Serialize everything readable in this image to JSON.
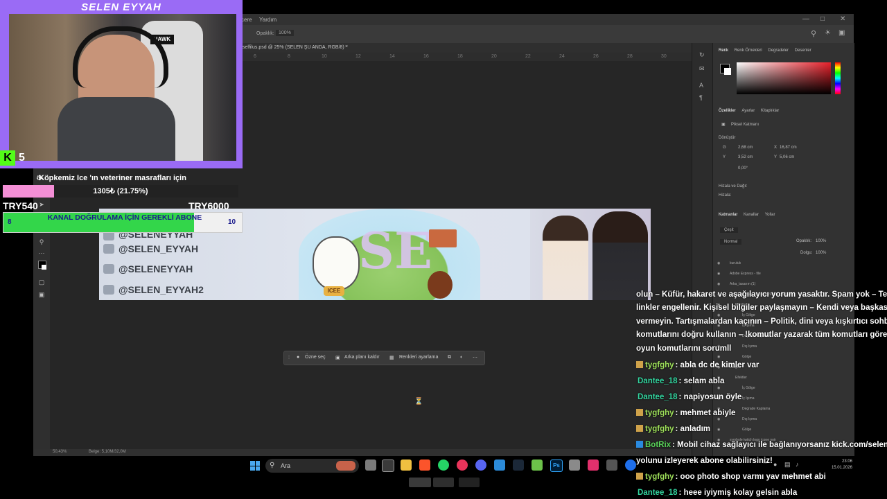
{
  "stream": {
    "streamer_name": "SELEN EYYAH",
    "kick_count": "5"
  },
  "photoshop": {
    "menu_visible": [
      "cere",
      "Yardım"
    ],
    "options": {
      "opacity_label": "Opaklık:",
      "opacity_value": "100%"
    },
    "document_tab": "selfilus.psd @ 25% (SELEN ŞU ANDA, RGB/8)",
    "ruler_ticks": [
      "6",
      "8",
      "10",
      "12",
      "14",
      "16",
      "18",
      "20",
      "22",
      "24",
      "26",
      "28",
      "30"
    ],
    "status_zoom": "50,43%",
    "status_size": "Belge: 5,10M/32,0M",
    "context_bar": {
      "select_label": "Özne seç",
      "remove_bg_label": "Arka planı kaldır",
      "color_adjust_label": "Renkleri ayarlama"
    },
    "panels": {
      "color_tabs": [
        "Renk",
        "Renk Örnekleri",
        "Degradeler",
        "Desenler"
      ],
      "props_tabs": [
        "Özellikler",
        "Ayarlar",
        "Kitaplıklar"
      ],
      "smart_object": "Piksel Katmanı",
      "transform_label": "Dönüştür",
      "w": "2,68 cm",
      "h": "3,52 cm",
      "x": "16,87 cm",
      "y": "5,06 cm",
      "angle": "0,00°",
      "align_label": "Hizala ve Dağıt",
      "align_sub": "Hizala:",
      "layers_tabs": [
        "Katmanlar",
        "Kanallar",
        "Yollar"
      ],
      "kind_label": "Çeşit",
      "blend_mode": "Normal",
      "opacity_label": "Opaklık:",
      "opacity_value": "100%",
      "fill_label": "Dolgu:",
      "fill_value": "100%",
      "layers": [
        "kuruluk",
        "Adobe Express - file",
        "Arka_tasarım (1)",
        "ChatGPT Image 15 Oca 2026 22_53_25",
        "Efektler",
        "İç Gölge",
        "İç Işıma",
        "Degrade Kaplama",
        "Dış Işıma",
        "Gölge",
        "images",
        "Efektler",
        "İç Gölge",
        "İç Işıma",
        "Degrade Kaplama",
        "Dış Işıma",
        "Gölge",
        "symbole twitch logo icone noir"
      ]
    }
  },
  "banner": {
    "handles": [
      "@SELENEYYAH",
      "@SELEN_EYYAH",
      "@SELENEYYAH",
      "@SELEN_EYYAH2"
    ],
    "dog_tag": "ICEE",
    "monogram": "SE"
  },
  "goal": {
    "title": "Köpkemiz Ice 'ın veteriner masrafları için",
    "progress_text": "1305₺ (21.75%)",
    "progress_fraction": 0.2175,
    "min_label": "TRY540",
    "max_label": "TRY6000",
    "fill_color": "#f48fd6"
  },
  "sub_goal": {
    "text": "KANAL DOĞRULAMA İÇİN GEREKLİ ABONE",
    "current": "8",
    "target": "10",
    "progress_fraction": 0.8,
    "fill_color": "#33d64a"
  },
  "chat": {
    "rules": [
      "olun – Küfür, hakaret ve aşağılayıcı yorum yasaktır. Spam yok – Tekrarlayan",
      "linkler engellenir. Kişisel bilgiler paylaşmayın – Kendi veya başkasının bilgil",
      "vermeyin. Tartışmalardan kaçının – Politik, dini veya kışkırtıcı sohbetler yas",
      "komutlarını doğru kullanın – !komutlar yazarak tüm komutları görebilirsiniz.",
      "oyun komutlarını sorumll"
    ],
    "messages": [
      {
        "user": "tygfghy",
        "color": "#9ee05a",
        "badge": true,
        "text": ": abla dc de kimler var"
      },
      {
        "user": "Dantee_18",
        "color": "#33d6a0",
        "badge": false,
        "text": ": selam abla"
      },
      {
        "user": "Dantee_18",
        "color": "#33d6a0",
        "badge": false,
        "text": ": napiyosun öyle"
      },
      {
        "user": "tygfghy",
        "color": "#9ee05a",
        "badge": true,
        "text": ": mehmet abiyle"
      },
      {
        "user": "tygfghy",
        "color": "#9ee05a",
        "badge": true,
        "text": ": anladım"
      },
      {
        "user": "BotRix",
        "color": "#5ad65a",
        "badge": true,
        "text": ": Mobil cihaz sağlayıcı ile bağlanıyorsanız kick.com/seleneyyah"
      },
      {
        "user": "",
        "color": "#ffffff",
        "badge": false,
        "text": "yolunu izleyerek abone olabilirsiniz!"
      },
      {
        "user": "tygfghy",
        "color": "#9ee05a",
        "badge": true,
        "text": ": ooo photo shop varmı yav mehmet abi"
      },
      {
        "user": "Dantee_18",
        "color": "#33d6a0",
        "badge": false,
        "text": ": heee iyiymiş kolay gelsin abla"
      }
    ]
  },
  "taskbar": {
    "search_placeholder": "Ara",
    "time": "23:06",
    "date": "15.01.2026"
  }
}
